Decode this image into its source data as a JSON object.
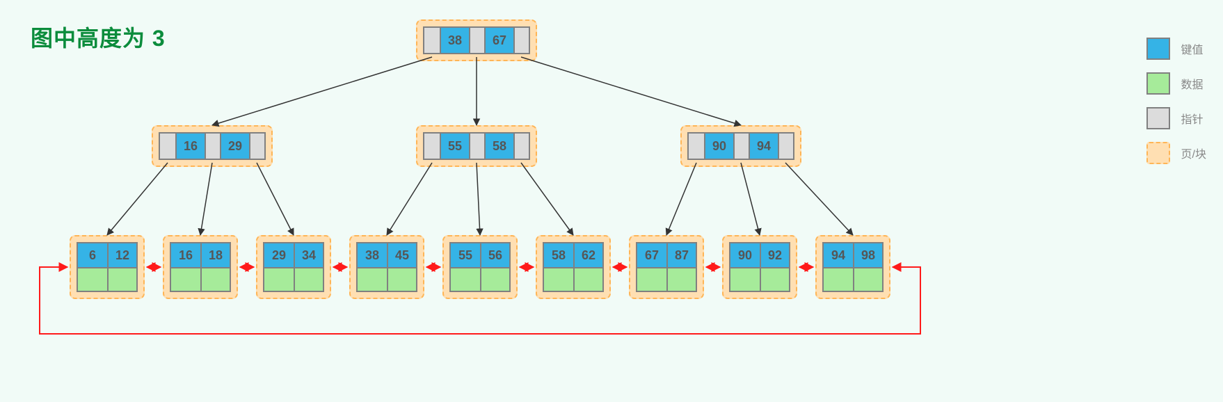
{
  "title": "图中高度为 3",
  "legend": {
    "key": "键值",
    "data": "数据",
    "pointer": "指针",
    "page": "页/块"
  },
  "root": {
    "k1": "38",
    "k2": "67"
  },
  "mid": [
    {
      "k1": "16",
      "k2": "29"
    },
    {
      "k1": "55",
      "k2": "58"
    },
    {
      "k1": "90",
      "k2": "94"
    }
  ],
  "leaves": [
    {
      "k1": "6",
      "k2": "12"
    },
    {
      "k1": "16",
      "k2": "18"
    },
    {
      "k1": "29",
      "k2": "34"
    },
    {
      "k1": "38",
      "k2": "45"
    },
    {
      "k1": "55",
      "k2": "56"
    },
    {
      "k1": "58",
      "k2": "62"
    },
    {
      "k1": "67",
      "k2": "87"
    },
    {
      "k1": "90",
      "k2": "92"
    },
    {
      "k1": "94",
      "k2": "98"
    }
  ]
}
